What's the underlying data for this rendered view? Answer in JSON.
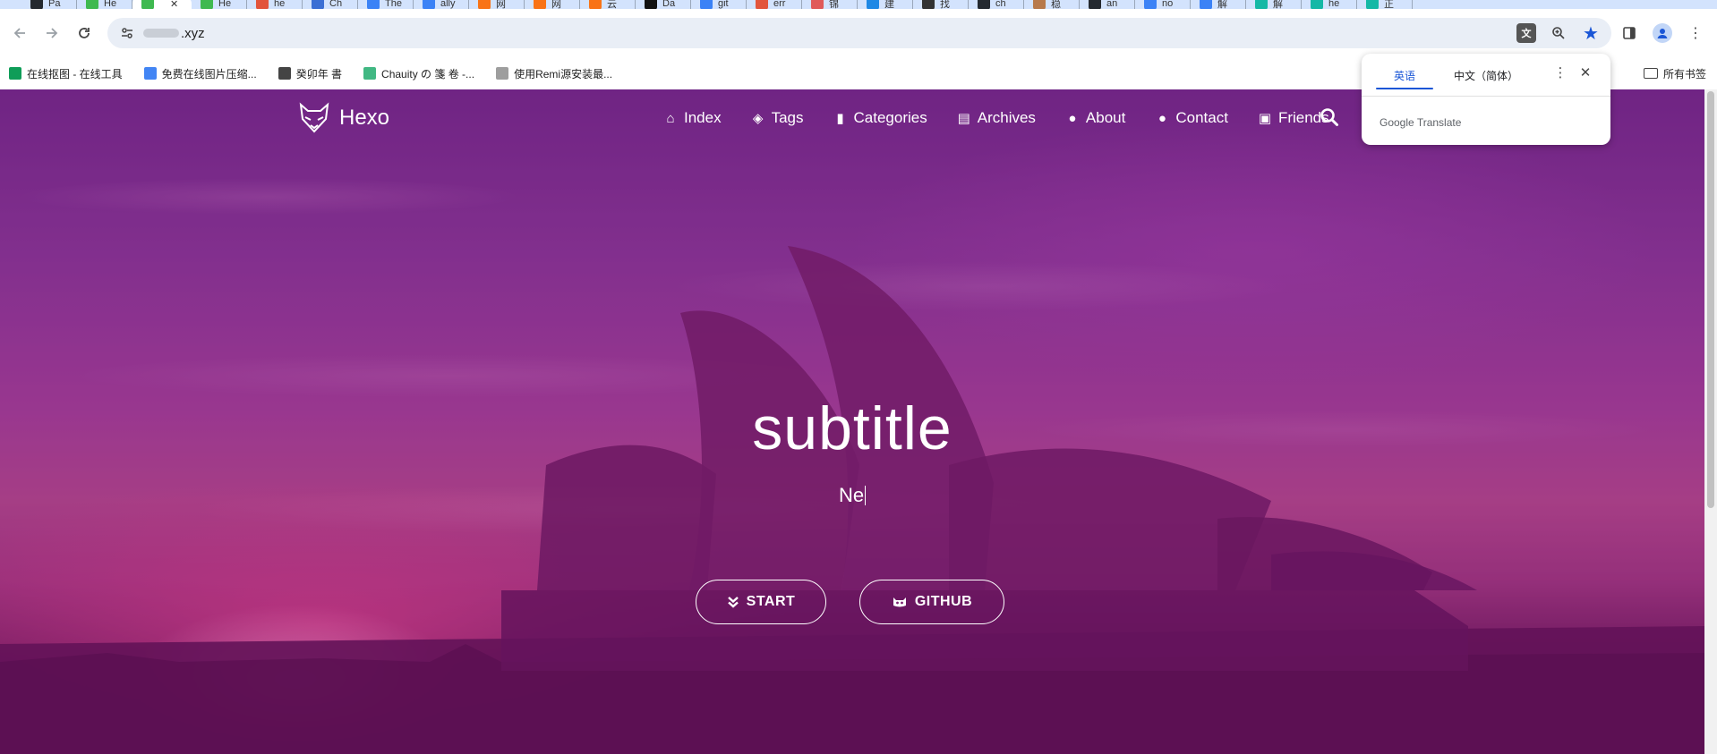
{
  "browser": {
    "tabs": [
      {
        "label": "Pa",
        "color": "#24292f"
      },
      {
        "label": "He",
        "color": "#3fb950"
      },
      {
        "label": "",
        "color": "#3fb950",
        "active": true
      },
      {
        "label": "He",
        "color": "#3fb950"
      },
      {
        "label": "he",
        "color": "#e2553c"
      },
      {
        "label": "Ch",
        "color": "#3b6fd4"
      },
      {
        "label": "The",
        "color": "#3b82f6"
      },
      {
        "label": "ally",
        "color": "#3b82f6"
      },
      {
        "label": "网",
        "color": "#f97316"
      },
      {
        "label": "网",
        "color": "#f97316"
      },
      {
        "label": "云",
        "color": "#f97316"
      },
      {
        "label": "Da",
        "color": "#111111"
      },
      {
        "label": "git",
        "color": "#3b82f6"
      },
      {
        "label": "err",
        "color": "#e2553c"
      },
      {
        "label": "锦",
        "color": "#e05a5a"
      },
      {
        "label": "建",
        "color": "#1e88e5"
      },
      {
        "label": "找",
        "color": "#333333"
      },
      {
        "label": "ch",
        "color": "#24292f"
      },
      {
        "label": "稳",
        "color": "#b7794b"
      },
      {
        "label": "an",
        "color": "#24292f"
      },
      {
        "label": "no",
        "color": "#3b82f6"
      },
      {
        "label": "解",
        "color": "#3b82f6"
      },
      {
        "label": "解",
        "color": "#14b8a6"
      },
      {
        "label": "he",
        "color": "#14b8a6"
      },
      {
        "label": "正",
        "color": "#14b8a6"
      }
    ],
    "active_tab_close": "✕",
    "url_suffix": ".xyz",
    "bookmarks": [
      {
        "label": "在线抠图 - 在线工具",
        "icon": "green-t-icon",
        "color": "#0f9d58"
      },
      {
        "label": "免费在线图片压缩...",
        "icon": "magic-wand-icon",
        "color": "#4285f4"
      },
      {
        "label": "癸卯年 書",
        "icon": "globe-icon",
        "color": "#444444"
      },
      {
        "label": "Chauity の 箋 卷 -...",
        "icon": "vue-icon",
        "color": "#41b883"
      },
      {
        "label": "使用Remi源安装最...",
        "icon": "image-icon",
        "color": "#9e9e9e"
      }
    ],
    "all_bookmarks_label": "所有书签"
  },
  "site": {
    "brand": "Hexo",
    "menu": [
      {
        "label": "Index",
        "icon": "home-icon",
        "glyph": "⌂"
      },
      {
        "label": "Tags",
        "icon": "tags-icon",
        "glyph": "◈"
      },
      {
        "label": "Categories",
        "icon": "bookmark-icon",
        "glyph": "▮"
      },
      {
        "label": "Archives",
        "icon": "archive-icon",
        "glyph": "▤"
      },
      {
        "label": "About",
        "icon": "user-circle-icon",
        "glyph": "●"
      },
      {
        "label": "Contact",
        "icon": "comments-icon",
        "glyph": "●"
      },
      {
        "label": "Friends",
        "icon": "address-card-icon",
        "glyph": "▣"
      }
    ],
    "hero": {
      "title": "subtitle",
      "subtitle_typed": "Ne",
      "start_label": "START",
      "github_label": "GITHUB"
    }
  },
  "translate_popup": {
    "source_lang": "英语",
    "target_lang": "中文（简体）",
    "brand": "Google Translate"
  },
  "colors": {
    "accent_blue": "#1a56d6",
    "hero_overlay": "#781470"
  }
}
